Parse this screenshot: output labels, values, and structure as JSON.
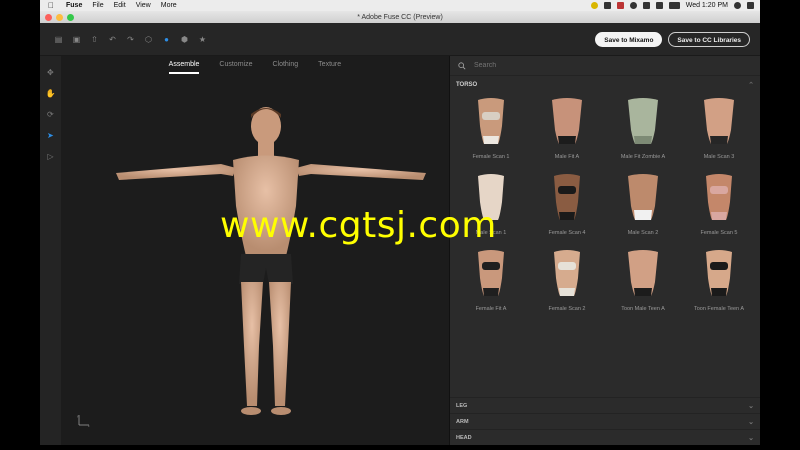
{
  "menubar": {
    "app": "Fuse",
    "items": [
      "File",
      "Edit",
      "View",
      "More"
    ],
    "datetime": "Wed 1:20 PM"
  },
  "window": {
    "title": "* Adobe Fuse CC (Preview)"
  },
  "toolbar": {
    "icons": [
      "import-icon",
      "open-icon",
      "save-icon",
      "undo-icon",
      "redo-icon",
      "cube-icon",
      "sphere-icon",
      "box-icon",
      "star-icon"
    ],
    "save_mixamo": "Save to Mixamo",
    "save_cc": "Save to CC Libraries"
  },
  "rail": [
    "orbit-icon",
    "pan-icon",
    "rotate-icon",
    "select-arrow-icon",
    "export-icon"
  ],
  "tabs": [
    "Assemble",
    "Customize",
    "Clothing",
    "Texture"
  ],
  "active_tab": "Assemble",
  "search": {
    "placeholder": "Search"
  },
  "panel": {
    "section": "TORSO",
    "items": [
      "Female Scan 1",
      "Male Fit A",
      "Male Fit Zombie A",
      "Male Scan 3",
      "Male Scan 1",
      "Female Scan 4",
      "Male Scan 2",
      "Female Scan 5",
      "Female Fit A",
      "Female Scan 2",
      "Toon Male Teen A",
      "Toon Female Teen A"
    ],
    "collapsed": [
      "LEG",
      "ARM",
      "HEAD"
    ]
  },
  "axis": {
    "x": "x",
    "y": "y"
  },
  "watermark": "www.cgtsj.com",
  "colors": {
    "accent": "#2d8ee6",
    "watermark": "#ffff00"
  }
}
